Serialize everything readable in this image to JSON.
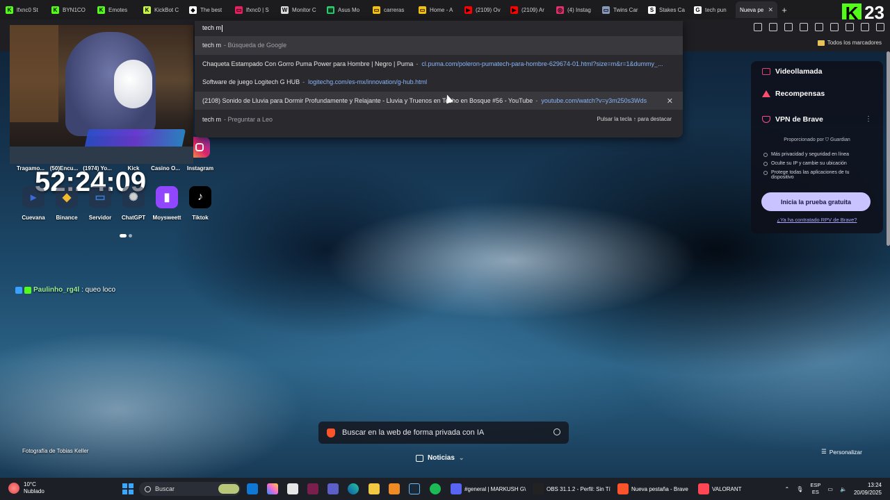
{
  "tabs": [
    {
      "label": "lfxnc0 St",
      "color": "#53fc18",
      "glyph": "K"
    },
    {
      "label": "BYN1CO",
      "color": "#53fc18",
      "glyph": "K"
    },
    {
      "label": "Emotes",
      "color": "#53fc18",
      "glyph": "K"
    },
    {
      "label": "KickBot C",
      "color": "#c7f542",
      "glyph": "K"
    },
    {
      "label": "The best",
      "color": "#ffffff",
      "glyph": "◆"
    },
    {
      "label": "lfxnc0 | S",
      "color": "#e91e63",
      "glyph": "▭"
    },
    {
      "label": "Monitor C",
      "color": "#dddddd",
      "glyph": "W"
    },
    {
      "label": "Asus Mo",
      "color": "#2ecc71",
      "glyph": "▤"
    },
    {
      "label": "carreras",
      "color": "#f4c20d",
      "glyph": "▭"
    },
    {
      "label": "Home - A",
      "color": "#f4c20d",
      "glyph": "▭"
    },
    {
      "label": "(2109) Ov",
      "color": "#ff0000",
      "glyph": "▶"
    },
    {
      "label": "(2109) Ar",
      "color": "#ff0000",
      "glyph": "▶"
    },
    {
      "label": "(4) Instag",
      "color": "#e1306c",
      "glyph": "◎"
    },
    {
      "label": "Twins Car",
      "color": "#8899bb",
      "glyph": "▭"
    },
    {
      "label": "Stakes Ca",
      "color": "#ffffff",
      "glyph": "S"
    },
    {
      "label": "tech pun",
      "color": "#ffffff",
      "glyph": "G"
    }
  ],
  "active_tab": {
    "label": "Nueva pe",
    "close": "✕"
  },
  "new_tab": "+",
  "kick_badge": {
    "logo": "K",
    "count": "23"
  },
  "bookmarks": {
    "all_label": "Todos los marcadores"
  },
  "omnibox": {
    "query": "tech m",
    "suggestions": [
      {
        "title": "tech m",
        "sub": "- Búsqueda de Google",
        "url": "",
        "highlight": true
      },
      {
        "title": "Chaqueta Estampado Con Gorro Puma Power para Hombre | Negro | Puma",
        "sub": "-",
        "url": "cl.puma.com/poleron-pumatech-para-hombre-629674-01.html?size=m&r=1&dummy_...",
        "highlight": false
      },
      {
        "title": "Software de juego Logitech G HUB",
        "sub": "-",
        "url": "logitechg.com/es-mx/innovation/g-hub.html",
        "highlight": false
      },
      {
        "title": "(2108) Sonido de Lluvia para Dormir Profundamente y Relajante - Lluvia y Truenos en Techo en Bosque #56 - YouTube",
        "sub": "-",
        "url": "youtube.com/watch?v=y3m250s3Wds",
        "highlight": true,
        "close": "✕"
      },
      {
        "title": "tech m",
        "sub": "- Preguntar a Leo",
        "url": "",
        "highlight": false,
        "hint": "Pulsar la tecla ↑ para destacar"
      }
    ]
  },
  "clock": "52:24:09",
  "shortcuts_row1": [
    "Tragamo...",
    "(50)Encu...",
    "(1974) Yo...",
    "Kick",
    "Casino O...",
    "Instagram"
  ],
  "shortcuts_row2": [
    {
      "label": "Cuevana",
      "glyph": "▸",
      "color": "#3a6bd6"
    },
    {
      "label": "Binance",
      "glyph": "◆",
      "color": "#f3ba2f"
    },
    {
      "label": "Servidor",
      "glyph": "▭",
      "color": "#3b7bd4"
    },
    {
      "label": "ChatGPT",
      "glyph": "✺",
      "color": "#d0d0d0"
    },
    {
      "label": "Moysweett",
      "glyph": "▮",
      "color": "#9146ff"
    },
    {
      "label": "Tiktok",
      "glyph": "♪",
      "color": "#ffffff"
    }
  ],
  "chat": {
    "user": "Paulinho_rg4l",
    "message": ": queo loco"
  },
  "brave_panel": {
    "videollamada": "Videollamada",
    "recompensas": "Recompensas",
    "vpn_title": "VPN de Brave",
    "menu": "⋮",
    "provided_by": "Proporcionado por",
    "provider": "Guardian",
    "benefits": [
      "Más privacidad y seguridad en línea",
      "Oculte su IP y cambie su ubicación",
      "Protege todas las aplicaciones de tu dispositivo"
    ],
    "cta": "Inicia la prueba gratuita",
    "link": "¿Ya ha contratado RPV de Brave?"
  },
  "private_search": {
    "placeholder": "Buscar en la web de forma privada con IA"
  },
  "news": {
    "label": "Noticias",
    "chevron": "⌄"
  },
  "photo_credit": "Fotografía de Tobias Keller",
  "customize": "Personalizar",
  "taskbar": {
    "weather_temp": "10°C",
    "weather_desc": "Nublado",
    "search": "Buscar",
    "apps_labeled": [
      {
        "label": "#general | MARKUSH G\\",
        "color": "#5865f2"
      },
      {
        "label": "OBS 31.1.2 - Perfil: Sin Tí",
        "color": "#222222"
      },
      {
        "label": "Nueva pestaña - Brave",
        "color": "#fb542b"
      },
      {
        "label": "VALORANT",
        "color": "#ff4655"
      }
    ],
    "lang_top": "ESP",
    "lang_bottom": "ES",
    "time": "13:24",
    "date": "20/09/2025"
  }
}
